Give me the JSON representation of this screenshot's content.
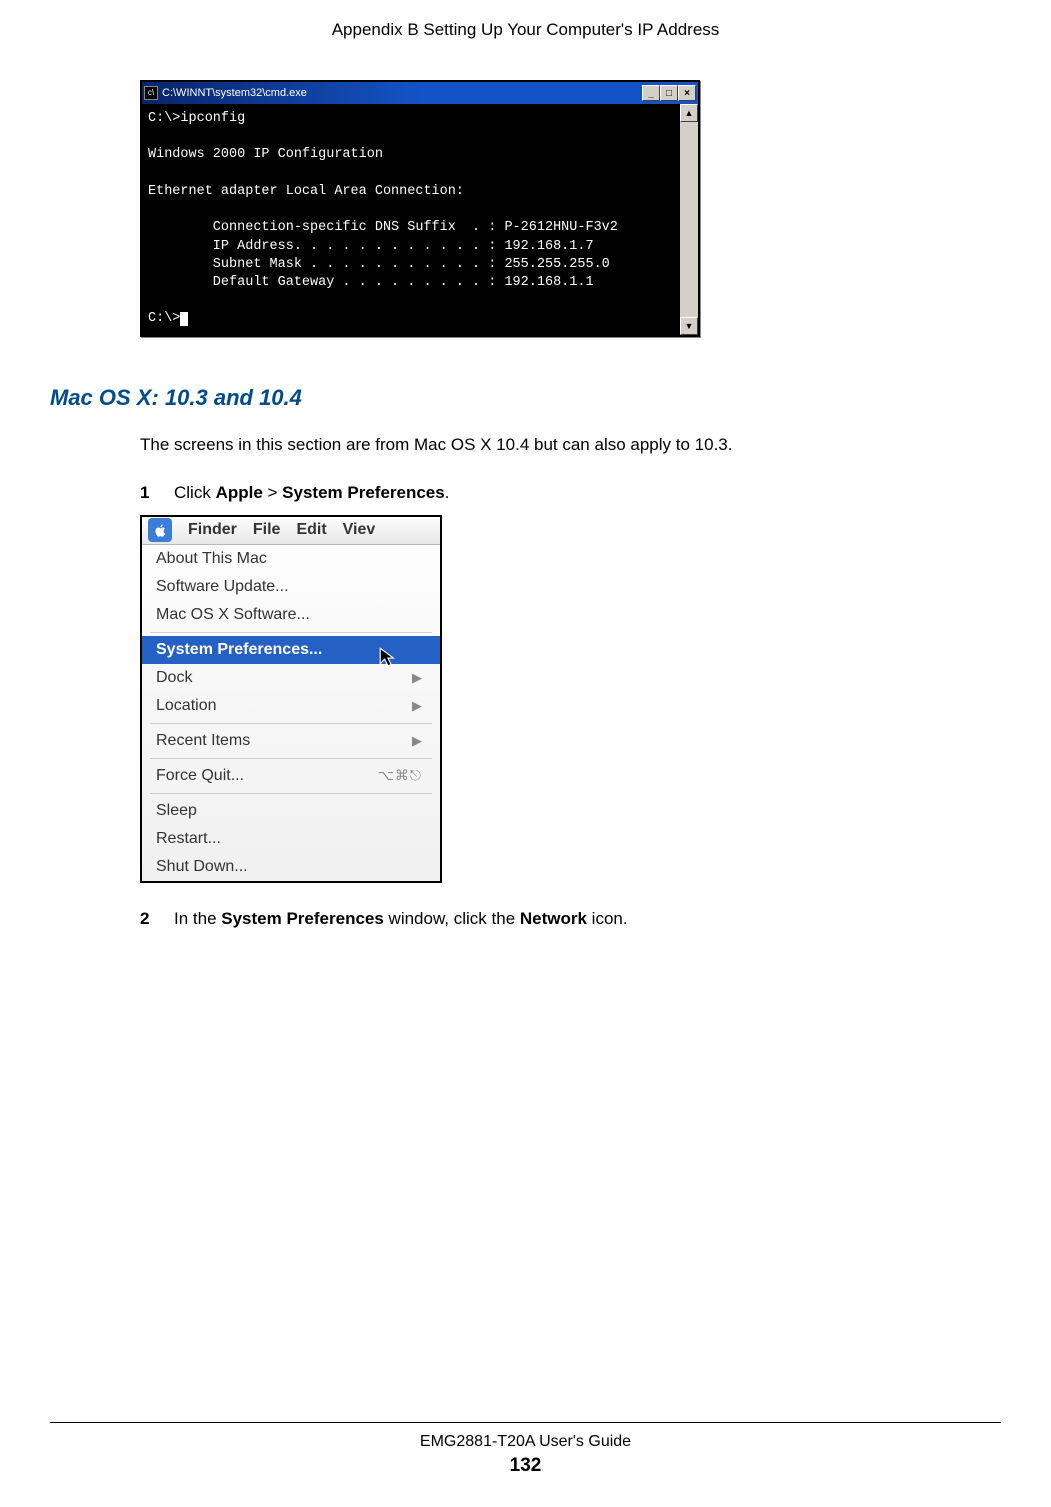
{
  "header": {
    "running_title": "Appendix B Setting Up Your Computer's IP Address"
  },
  "cmd": {
    "window_title": "C:\\WINNT\\system32\\cmd.exe",
    "lines": {
      "l1": "C:\\>ipconfig",
      "l2": "",
      "l3": "Windows 2000 IP Configuration",
      "l4": "",
      "l5": "Ethernet adapter Local Area Connection:",
      "l6": "",
      "l7": "        Connection-specific DNS Suffix  . : P-2612HNU-F3v2",
      "l8": "        IP Address. . . . . . . . . . . . : 192.168.1.7",
      "l9": "        Subnet Mask . . . . . . . . . . . : 255.255.255.0",
      "l10": "        Default Gateway . . . . . . . . . : 192.168.1.1",
      "l11": "",
      "l12": "C:\\>"
    },
    "ctrl_min": "_",
    "ctrl_max": "□",
    "ctrl_close": "×",
    "scroll_up": "▲",
    "scroll_down": "▼"
  },
  "section": {
    "heading": "Mac OS X: 10.3 and 10.4",
    "intro": "The screens in this section are from Mac OS X 10.4 but can also apply to 10.3."
  },
  "steps": {
    "s1": {
      "num": "1",
      "pre": "Click ",
      "b1": "Apple",
      "mid": " > ",
      "b2": "System Preferences",
      "post": "."
    },
    "s2": {
      "num": "2",
      "pre": "In the ",
      "b1": "System Preferences",
      "mid": " window, click the ",
      "b2": "Network",
      "post": " icon."
    }
  },
  "mac": {
    "menubar": {
      "finder": "Finder",
      "file": "File",
      "edit": "Edit",
      "view": "Viev"
    },
    "items": {
      "about": "About This Mac",
      "update": "Software Update...",
      "osx_software": "Mac OS X Software...",
      "sysprefs": "System Preferences...",
      "dock": "Dock",
      "location": "Location",
      "recent": "Recent Items",
      "forcequit": "Force Quit...",
      "forcequit_shortcut": "⌥⌘⎋",
      "sleep": "Sleep",
      "restart": "Restart...",
      "shutdown": "Shut Down...",
      "submenu_arrow": "▶"
    }
  },
  "footer": {
    "guide": "EMG2881-T20A User's Guide",
    "page": "132"
  }
}
